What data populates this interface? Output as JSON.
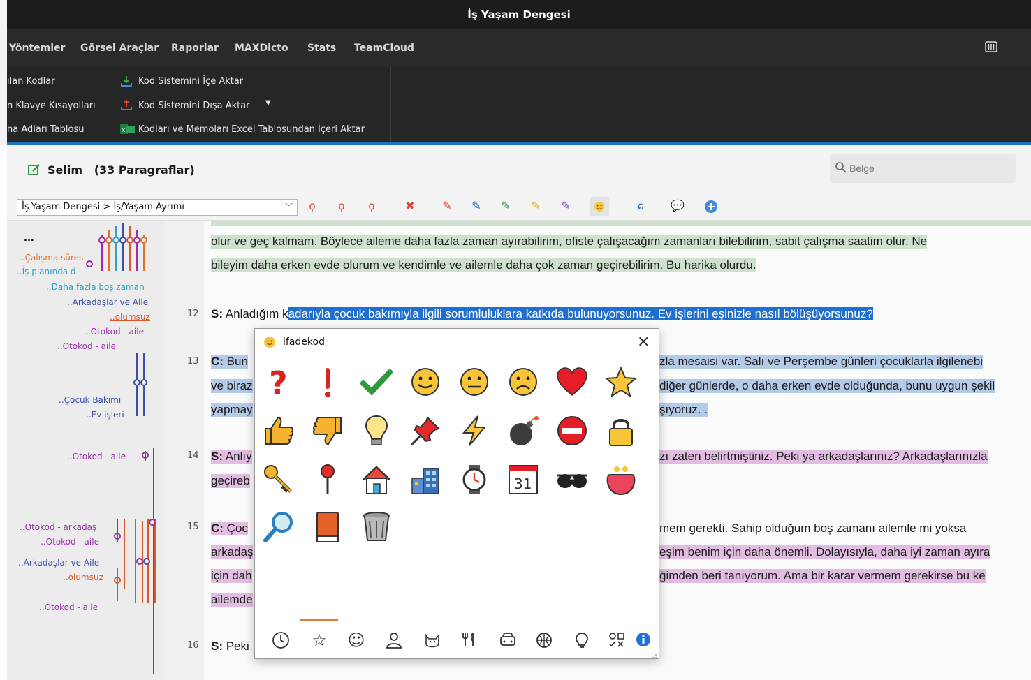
{
  "window": {
    "title": "İş Yaşam Dengesi"
  },
  "menu": {
    "items": [
      "Yöntemler",
      "Görsel Araçlar",
      "Raporlar",
      "MAXDicto",
      "Stats",
      "TeamCloud"
    ]
  },
  "ribbon": {
    "left_items": [
      "ılan Kodlar",
      "n Klavye Kısayolları",
      "na Adları Tablosu"
    ],
    "import_code_system": "Kod Sistemini İçe Aktar",
    "export_code_system": "Kod Sistemini Dışa Aktar",
    "import_excel": "Kodları ve Memoları Excel Tablosundan İçeri Aktar"
  },
  "document": {
    "title": "Selim   (33 Paragraflar)"
  },
  "search": {
    "placeholder": "Belge"
  },
  "toolbar": {
    "code_select_value": "İş-Yaşam Dengesi > İş/Yaşam Ayrımı"
  },
  "codes": [
    {
      "label": "...",
      "color": "#222222"
    },
    {
      "label": "..Çalışma süres",
      "color": "#e0702a"
    },
    {
      "label": "..İş planında d",
      "color": "#2fa3c9"
    },
    {
      "label": "..Daha fazla boş zaman",
      "color": "#2fa3c9"
    },
    {
      "label": "..Arkadaşlar ve Aile",
      "color": "#3c4fa8"
    },
    {
      "label": "..olumsuz",
      "color": "#d9582c"
    },
    {
      "label": "..Otokod - aile",
      "color": "#9a30a8"
    },
    {
      "label": "..Otokod - aile",
      "color": "#9a30a8"
    },
    {
      "label": "..Çocuk Bakımı",
      "color": "#3c4fa8"
    },
    {
      "label": "..Ev işleri",
      "color": "#3c4fa8"
    },
    {
      "label": "..Otokod - aile",
      "color": "#9a30a8"
    },
    {
      "label": "..Otokod - arkadaş",
      "color": "#9a30a8"
    },
    {
      "label": "..Otokod - aile",
      "color": "#9a30a8"
    },
    {
      "label": "..Arkadaşlar ve Aile",
      "color": "#3c4fa8"
    },
    {
      "label": "..olumsuz",
      "color": "#d9582c"
    },
    {
      "label": "..Otokod - aile",
      "color": "#9a30a8"
    }
  ],
  "line_numbers": [
    "12",
    "13",
    "14",
    "15",
    "16"
  ],
  "paragraphs": {
    "p11_line1": "olur ve geç kalmam. Böylece aileme daha fazla zaman ayırabilirim, ofiste çalışacağım zamanları bilebilirim, sabit çalışma saatim olur. Ne",
    "p11_line2": "bileyim daha erken evde olurum ve kendimle ve ailemle daha çok zaman geçirebilirim. Bu harika olurdu.",
    "p12_speaker": "S:",
    "p12_pre": " Anladığım k",
    "p12_sel": "adarıyla çocuk bakımıyla ilgili sorumluluklara katkıda bulunuyorsunuz. Ev işlerini eşinizle nasıl bölüşüyorsunuz?",
    "p13_speaker": "C:",
    "p13_a": " Bun",
    "p13_b": "zla mesaisi var. Salı ve Perşembe günleri çocuklarla ilgilenebi",
    "p13_c": "ve biraz",
    "p13_d": "diğer günlerde, o daha erken evde olduğunda, bunu uygun şekil",
    "p13_e": "yapmay",
    "p13_f": "şıyoruz. .",
    "p14_speaker": "S:",
    "p14_a": " Anlıy",
    "p14_b": "zı zaten belirtmiştiniz. Peki ya arkadaşlarınız? Arkadaşlarınızla",
    "p14_c": "geçireb",
    "p15_speaker": "C:",
    "p15_a": " Çoc",
    "p15_b": "mem gerekti. Sahip olduğum boş zamanı ailemle mi yoksa",
    "p15_c": "arkadaş",
    "p15_d": "eşim benim için daha önemli. Dolayısıyla, daha iyi zaman ayıra",
    "p15_e": "için dah",
    "p15_f": "ğimden beri tanıyorum. Ama bir karar vermem gerekirse bu ke",
    "p15_g": "ailemde",
    "p16_speaker": "S:",
    "p16_a": " Peki"
  },
  "dialog": {
    "title": "ifadekod",
    "close": "×",
    "emojis": [
      "question",
      "exclamation",
      "checkmark",
      "smile",
      "neutral-face",
      "sad-face",
      "heart",
      "star",
      "thumbs-up",
      "thumbs-down",
      "lightbulb",
      "pushpin",
      "lightning",
      "bomb",
      "no-entry",
      "lock",
      "key",
      "pin",
      "house",
      "office-building",
      "watch",
      "calendar",
      "sunglasses",
      "purse",
      "magnifier",
      "book",
      "trash-can"
    ],
    "calendar_day": "31",
    "tabs": [
      "recent",
      "favorites",
      "smileys",
      "people",
      "animals",
      "food",
      "travel",
      "activities",
      "objects",
      "symbols",
      "info"
    ]
  },
  "colors": {
    "accent": "#1a73c4",
    "selection": "#1f6fd1",
    "green_code": "#cfe0cf",
    "blue_code": "#b3cbe6",
    "pink_code": "#e2bde2",
    "tab_active": "#e67a3a"
  }
}
